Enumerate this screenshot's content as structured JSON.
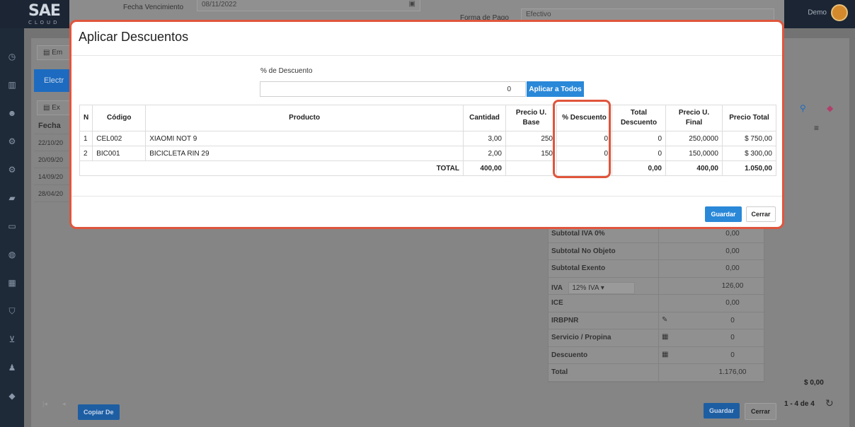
{
  "background": {
    "logo": "SAE",
    "logo_sub": "CLOUD",
    "fecha_vencimiento_label": "Fecha Vencimiento",
    "fecha_vencimiento_value": "08/11/2022",
    "forma_pago_label": "Forma de Pago",
    "forma_pago_value": "Efectivo",
    "user_name": "Demo",
    "emit_button": "Em",
    "tab_label": "Electr",
    "export_button": "Ex",
    "list_header": "Fecha",
    "list_dates": [
      "22/10/20",
      "20/09/20",
      "14/09/20",
      "28/04/20"
    ],
    "totals": [
      {
        "label": "Subtotal IVA 0%",
        "value": "0,00"
      },
      {
        "label": "Subtotal No Objeto",
        "value": "0,00"
      },
      {
        "label": "Subtotal Exento",
        "value": "0,00"
      },
      {
        "label": "IVA",
        "select": "12% IVA",
        "value": "126,00"
      },
      {
        "label": "ICE",
        "value": "0,00"
      },
      {
        "label": "IRBPNR",
        "value": "0"
      },
      {
        "label": "Servicio / Propina",
        "value": "0"
      },
      {
        "label": "Descuento",
        "value": "0"
      },
      {
        "label": "Total",
        "value": "1.176,00"
      }
    ],
    "amount_right": "$ 0,00",
    "pager": "1 - 4 de 4",
    "copy_from_button": "Copiar De",
    "save_button": "Guardar",
    "close_button": "Cerrar"
  },
  "modal": {
    "title": "Aplicar Descuentos",
    "discount_label": "% de Descuento",
    "discount_value": "0",
    "apply_all_button": "Aplicar a Todos",
    "columns": [
      "N",
      "Código",
      "Producto",
      "Cantidad",
      "Precio U. Base",
      "% Descuento",
      "Total Descuento",
      "Precio U. Final",
      "Precio Total"
    ],
    "rows": [
      {
        "n": "1",
        "codigo": "CEL002",
        "producto": "XIAOMI NOT 9",
        "cantidad": "3,00",
        "precio_base": "250",
        "descuento": "0",
        "total_descuento": "0",
        "precio_final": "250,0000",
        "precio_total": "$ 750,00"
      },
      {
        "n": "2",
        "codigo": "BIC001",
        "producto": "BICICLETA RIN 29",
        "cantidad": "2,00",
        "precio_base": "150",
        "descuento": "0",
        "total_descuento": "0",
        "precio_final": "150,0000",
        "precio_total": "$ 300,00"
      }
    ],
    "total_row": {
      "label": "TOTAL",
      "cantidad": "400,00",
      "total_descuento": "0,00",
      "precio_final": "400,00",
      "precio_total": "1.050,00"
    },
    "save_button": "Guardar",
    "close_button": "Cerrar"
  },
  "colors": {
    "accent": "#2a88d8",
    "highlight": "#e0553c",
    "sidebar": "#1e2a38"
  }
}
